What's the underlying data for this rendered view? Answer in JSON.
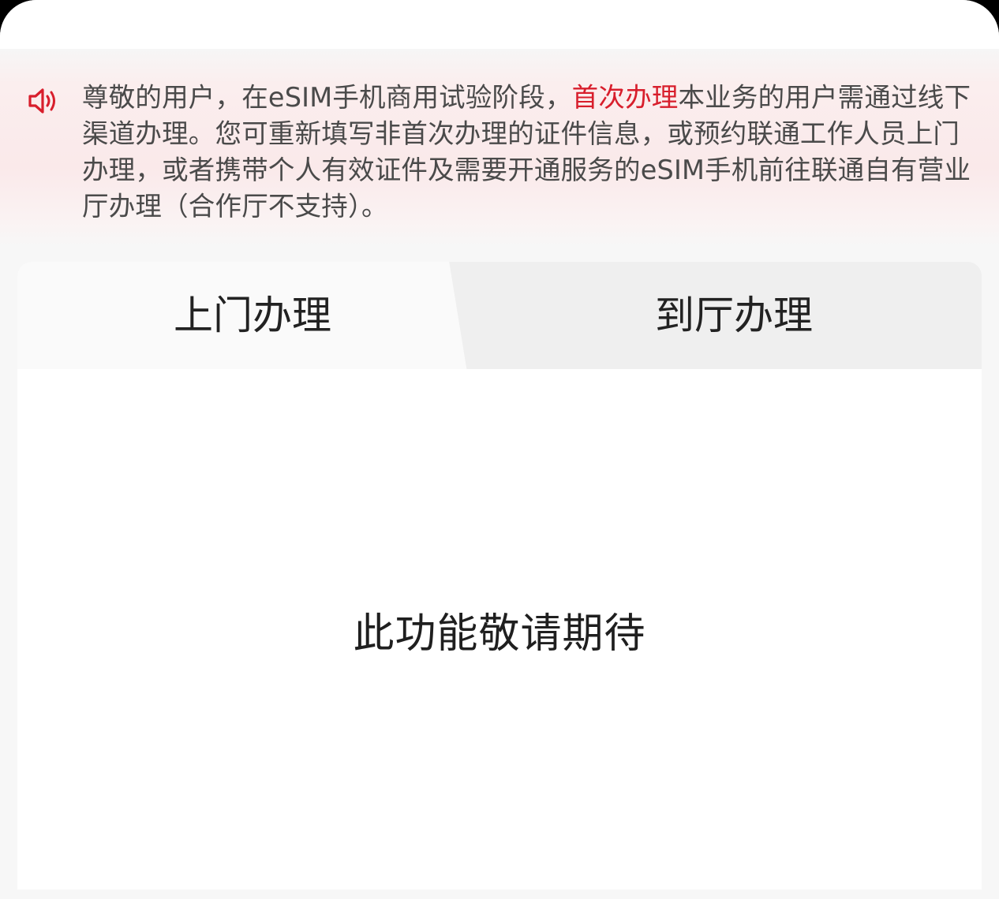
{
  "notice": {
    "icon": "speaker-icon",
    "text_before": "尊敬的用户，在eSIM手机商用试验阶段，",
    "highlight": "首次办理",
    "text_after": "本业务的用户需通过线下渠道办理。您可重新填写非首次办理的证件信息，或预约联通工作人员上门办理，或者携带个人有效证件及需要开通服务的eSIM手机前往联通自有营业厅办理（合作厅不支持）。",
    "highlight_color": "#d81e2c"
  },
  "tabs": [
    {
      "label": "上门办理",
      "selected": true
    },
    {
      "label": "到厅办理",
      "selected": false
    }
  ],
  "content": {
    "message": "此功能敬请期待"
  }
}
